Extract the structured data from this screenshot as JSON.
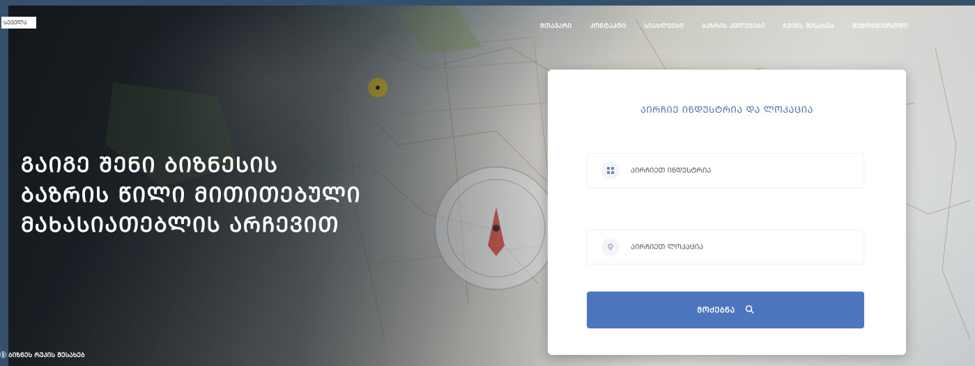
{
  "header": {
    "logo_text": "ᲡᲔᲕᲔᲚᲐ",
    "nav": [
      {
        "label": "ᲛᲗᲐᲕᲐᲠᲘ"
      },
      {
        "label": "ᲙᲝᲜᲢᲐᲙᲢᲘ"
      },
      {
        "label": "ᲡᲘᲐᲮᲚᲔᲔᲑᲘ"
      },
      {
        "label": "ᲑᲐᲖᲠᲘᲡ ᲙᲕᲚᲔᲕᲔᲑᲘ"
      },
      {
        "label": "ᲩᲕᲔᲜᲡ ᲨᲔᲡᲐᲮᲔᲑ"
      },
      {
        "label": "ᲨᲔᲛᲝᲒᲕᲘᲔᲠᲗᲓᲘ"
      }
    ]
  },
  "hero": {
    "headline_lines": [
      "ᲒᲐᲘᲒᲔ ᲨᲔᲜᲘ ᲑᲘᲖᲜᲔᲡᲘᲡ",
      "ᲑᲐᲖᲠᲘᲡ ᲬᲘᲚᲘ ᲛᲘᲗᲘᲗᲔᲑᲣᲚᲘ",
      "ᲛᲐᲮᲐᲡᲘᲐᲗᲔᲑᲚᲘᲡ ᲐᲠᲩᲔᲕᲘᲗ"
    ],
    "footer_note": "Ⓢ ᲑᲘᲖᲜᲔᲡ ᲠᲣᲙᲘᲡ ᲨᲔᲡᲐᲮᲔᲑ"
  },
  "search_card": {
    "title": "ᲐᲘᲠᲩᲘᲔ ᲘᲜᲓᲣᲡᲢᲠᲘᲐ ᲓᲐ ᲚᲝᲙᲐᲪᲘᲐ",
    "industry_placeholder": "ᲐᲘᲠᲩᲘᲔᲗ ᲘᲜᲓᲣᲡᲢᲠᲘᲐ",
    "location_placeholder": "ᲐᲘᲠᲩᲘᲔᲗ ᲚᲝᲙᲐᲪᲘᲐ",
    "search_label": "ᲛᲝᲫᲔᲑᲜᲐ",
    "industry_icon": "grid-icon",
    "location_icon": "pin-icon",
    "search_icon": "search-icon"
  },
  "colors": {
    "accent": "#4c76bd",
    "title_blue": "#4a72b8",
    "frame": "#34506c"
  }
}
